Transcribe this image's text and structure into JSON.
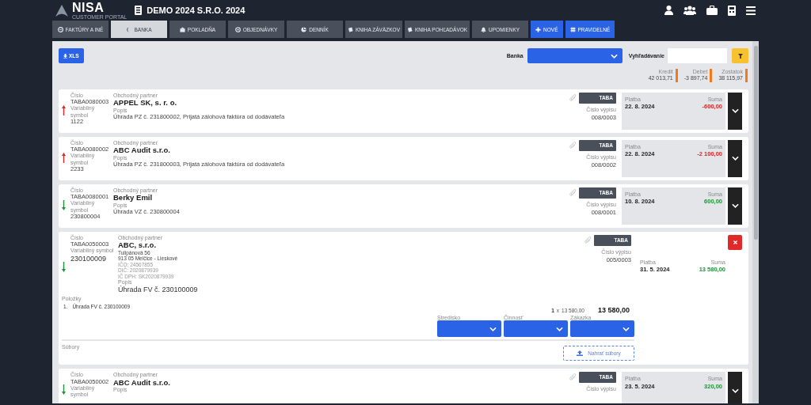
{
  "header": {
    "logo": "NISA",
    "logo_subtitle": "CUSTOMER PORTAL",
    "company": "DEMO 2024 S.R.O. 2024"
  },
  "tabs": [
    {
      "label": "FAKTÚRY A INÉ",
      "kind": "nav",
      "selected": false
    },
    {
      "label": "BANKA",
      "kind": "nav",
      "selected": true
    },
    {
      "label": "POKLADŇA",
      "kind": "nav",
      "selected": false
    },
    {
      "label": "OBJEDNÁVKY",
      "kind": "nav",
      "selected": false
    },
    {
      "label": "DENNÍK",
      "kind": "nav",
      "selected": false
    },
    {
      "label": "KNIHA ZÁVÄZKOV",
      "kind": "nav",
      "selected": false
    },
    {
      "label": "KNIHA POHĽADÁVOK",
      "kind": "nav",
      "selected": false
    },
    {
      "label": "UPOMIENKY",
      "kind": "nav",
      "selected": false
    },
    {
      "label": "NOVÉ",
      "kind": "action",
      "selected": false
    },
    {
      "label": "PRAVIDELNÉ",
      "kind": "action",
      "selected": false
    }
  ],
  "toolbar": {
    "export_button": "XLS",
    "bank_label": "Banka",
    "search_label": "Vyhľadávanie"
  },
  "summary": [
    {
      "label": "Kredit",
      "value": "42 013,71"
    },
    {
      "label": "Debet",
      "value": "-3 897,74"
    },
    {
      "label": "Zostatok",
      "value": "38 115,97"
    }
  ],
  "transactions": [
    {
      "expanded": false,
      "outgoing": true,
      "number_label": "Číslo",
      "number": "TABA0080003",
      "partner_label": "Obchodný partner",
      "partner": "APPEL SK, s. r. o.",
      "vs_label": "Variabilný symbol",
      "vs": "1122",
      "desc_label": "Popis",
      "desc": "Úhrada PZ č. 231800002, Prijatá zálohová faktúra od dodávateľa",
      "bank": "TABA",
      "statement_label": "Číslo výpisu",
      "statement": "008/0003",
      "date_label": "Platba",
      "date": "22. 8. 2024",
      "amount_label": "Suma",
      "amount": "-600,00"
    },
    {
      "expanded": false,
      "outgoing": true,
      "number_label": "Číslo",
      "number": "TABA0080002",
      "partner_label": "Obchodný partner",
      "partner": "ABC Audit s.r.o.",
      "vs_label": "Variabilný symbol",
      "vs": "2233",
      "desc_label": "Popis",
      "desc": "Úhrada PZ č. 231800003, Prijatá zálohová faktúra od dodávateľa",
      "bank": "TABA",
      "statement_label": "Číslo výpisu",
      "statement": "008/0002",
      "date_label": "Platba",
      "date": "22. 8. 2024",
      "amount_label": "Suma",
      "amount": "-2 100,00"
    },
    {
      "expanded": false,
      "outgoing": false,
      "number_label": "Číslo",
      "number": "TABA0080001",
      "partner_label": "Obchodný partner",
      "partner": "Berky Emil",
      "vs_label": "Variabilný symbol",
      "vs": "230800004",
      "desc_label": "Popis",
      "desc": "Úhrada VZ č. 230800004",
      "bank": "TABA",
      "statement_label": "Číslo výpisu",
      "statement": "008/0001",
      "date_label": "Platba",
      "date": "10. 8. 2024",
      "amount_label": "Suma",
      "amount": "600,00"
    },
    {
      "expanded": true,
      "outgoing": false,
      "number_label": "Číslo",
      "number": "TABA0050003",
      "partner_label": "Obchodný partner",
      "partner": "ABC, s.r.o.",
      "address": [
        "Tulipánová 56",
        "913 05 Melčice - Lieskové",
        "IČO: 24567855",
        "DIČ: 2020879939",
        "IČ DPH: SK2020879939"
      ],
      "vs_label": "Variabilný symbol",
      "vs": "230100009",
      "desc_label": "Popis",
      "desc": "Úhrada FV č. 230100009",
      "bank": "TABA",
      "statement_label": "Číslo výpisu",
      "statement": "005/0003",
      "date_label": "Platba",
      "date": "31. 5. 2024",
      "amount_label": "Suma",
      "amount": "13 580,00",
      "items_label": "Položky",
      "items": [
        {
          "index": "1.",
          "text": "Úhrada FV č. 230100009",
          "quantity": "1",
          "times_sign": "x",
          "unit_price": "13 580,00",
          "total": "13 580,00"
        }
      ],
      "selects": [
        {
          "label": "Stredisko"
        },
        {
          "label": "Činnosť"
        },
        {
          "label": "Zákazka"
        }
      ],
      "files_label": "Súbory",
      "upload_button": "Nahrať súbory"
    },
    {
      "expanded": false,
      "outgoing": false,
      "number_label": "Číslo",
      "number": "TABA0050002",
      "partner_label": "Obchodný partner",
      "partner": "ABC Audit s.r.o.",
      "vs_label": "Variabilný symbol",
      "desc_label": "Popis",
      "bank": "TABA",
      "statement_label": "Číslo výpisu",
      "date_label": "Platba",
      "date": "23. 5. 2024",
      "amount_label": "Suma",
      "amount": "320,00"
    }
  ]
}
